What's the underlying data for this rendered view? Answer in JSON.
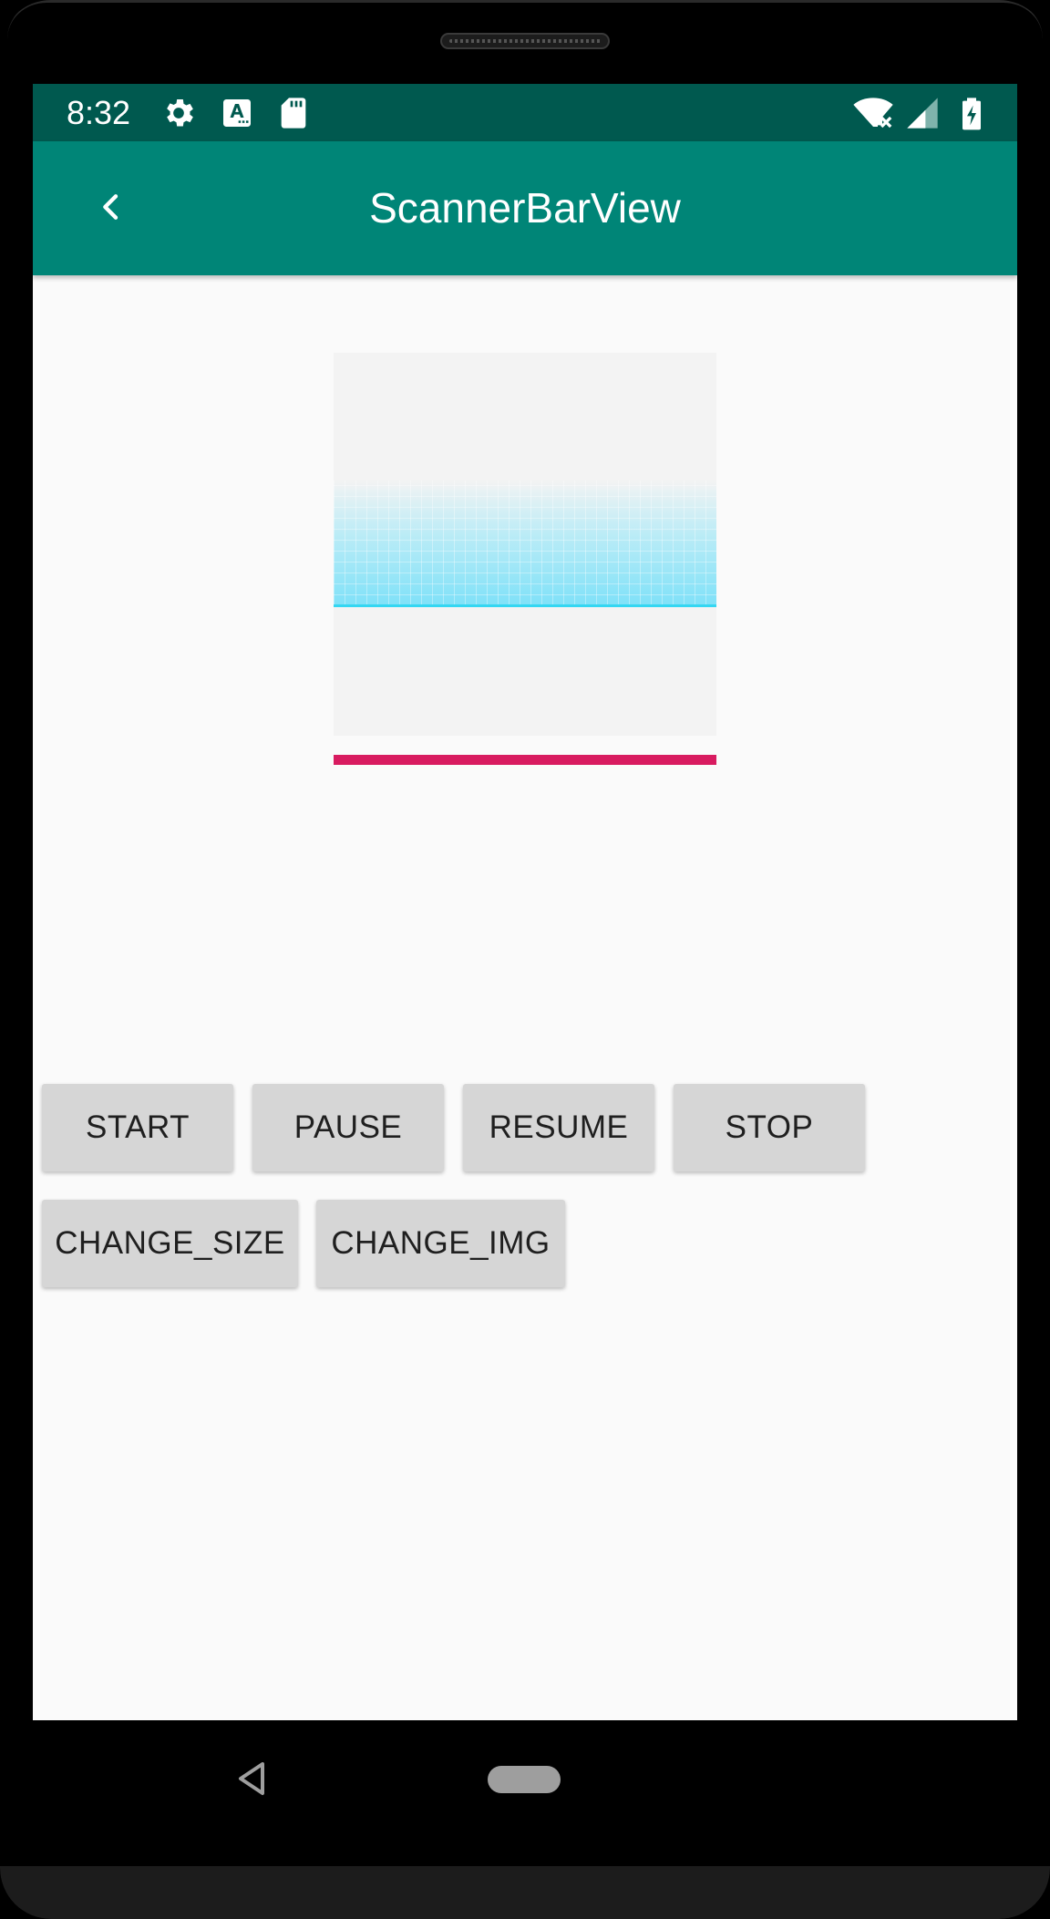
{
  "status_bar": {
    "time": "8:32",
    "icons": [
      "gear-icon",
      "text-a-icon",
      "sd-card-icon",
      "wifi-off-icon",
      "cell-signal-icon",
      "battery-charging-icon"
    ]
  },
  "app_bar": {
    "title": "ScannerBarView",
    "back_icon": "chevron-left-icon"
  },
  "scanner": {
    "scan_color": "#34d7f2",
    "progress_color": "#d81b60"
  },
  "buttons": {
    "start": "START",
    "pause": "PAUSE",
    "resume": "RESUME",
    "stop": "STOP",
    "change_size": "CHANGE_SIZE",
    "change_img": "CHANGE_IMG"
  },
  "colors": {
    "status_bar": "#00594f",
    "app_bar": "#008577",
    "background": "#fafafa",
    "button": "#d6d6d6"
  },
  "nav_bar": {
    "icons": [
      "nav-back-icon",
      "nav-home-pill-icon"
    ]
  }
}
